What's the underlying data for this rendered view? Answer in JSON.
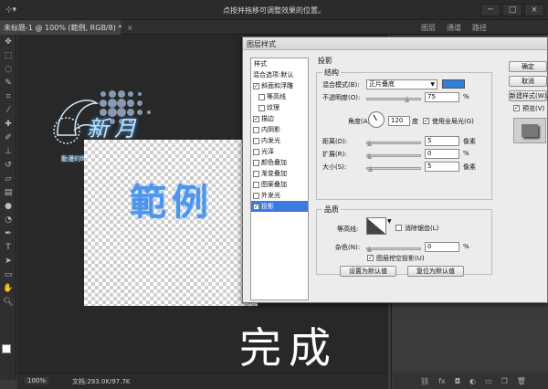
{
  "app": {
    "hint_text": "点按并拖移可调整效果的位置。",
    "tool_preset_icon": "crosshair-icon"
  },
  "document_tab": {
    "title": "未标题-1 @ 100% (範例, RGB/8) *",
    "close": "×"
  },
  "right_tabs": [
    "图层",
    "通道",
    "路径"
  ],
  "window_buttons": [
    "─",
    "□",
    "×"
  ],
  "canvas": {
    "sample_text": "範例",
    "logo_title": "新月",
    "logo_subtitle": "動漫的時期這比性   我們的一直很小心",
    "finish_text": "完成"
  },
  "status": {
    "zoom": "100%",
    "doc_info": "文档:293.0K/97.7K"
  },
  "dialog": {
    "title": "图层样式",
    "styles_header": "样式",
    "style_items": [
      {
        "label": "混合选项:默认",
        "checkbox": false,
        "checked": false,
        "indent": false,
        "selected": false
      },
      {
        "label": "斜面和浮雕",
        "checkbox": true,
        "checked": true,
        "indent": false,
        "selected": false
      },
      {
        "label": "等高线",
        "checkbox": true,
        "checked": false,
        "indent": true,
        "selected": false
      },
      {
        "label": "纹理",
        "checkbox": true,
        "checked": false,
        "indent": true,
        "selected": false
      },
      {
        "label": "描边",
        "checkbox": true,
        "checked": true,
        "indent": false,
        "selected": false
      },
      {
        "label": "内阴影",
        "checkbox": true,
        "checked": false,
        "indent": false,
        "selected": false
      },
      {
        "label": "内发光",
        "checkbox": true,
        "checked": false,
        "indent": false,
        "selected": false
      },
      {
        "label": "光泽",
        "checkbox": true,
        "checked": false,
        "indent": false,
        "selected": false
      },
      {
        "label": "颜色叠加",
        "checkbox": true,
        "checked": false,
        "indent": false,
        "selected": false
      },
      {
        "label": "渐变叠加",
        "checkbox": true,
        "checked": false,
        "indent": false,
        "selected": false
      },
      {
        "label": "图案叠加",
        "checkbox": true,
        "checked": false,
        "indent": false,
        "selected": false
      },
      {
        "label": "外发光",
        "checkbox": true,
        "checked": false,
        "indent": false,
        "selected": false
      },
      {
        "label": "投影",
        "checkbox": true,
        "checked": true,
        "indent": false,
        "selected": true
      }
    ],
    "section_title": "投影",
    "structure": {
      "title": "结构",
      "blend_mode_label": "混合模式(B):",
      "blend_mode_value": "正片叠底",
      "shadow_color": "#2f7fd8",
      "opacity_label": "不透明度(O):",
      "opacity_value": "75",
      "percent": "%",
      "angle_label": "角度(A):",
      "angle_value": "120",
      "degree": "度",
      "global_light_label": "使用全局光(G)",
      "global_light_checked": true,
      "distance_label": "距离(D):",
      "distance_value": "5",
      "spread_label": "扩展(R):",
      "spread_value": "0",
      "size_label": "大小(S):",
      "size_value": "5",
      "px": "像素"
    },
    "quality": {
      "title": "品质",
      "contour_label": "等高线:",
      "anti_alias_label": "消除锯齿(L)",
      "anti_alias_checked": false,
      "noise_label": "杂色(N):",
      "noise_value": "0",
      "knockout_label": "图层挖空投影(U)",
      "knockout_checked": true
    },
    "make_default": "设置为默认值",
    "reset_default": "复位为默认值",
    "ok": "确定",
    "cancel": "取消",
    "new_style": "新建样式(W)...",
    "preview_label": "预览(V)",
    "preview_checked": true
  },
  "tools": [
    "move-icon",
    "marquee-icon",
    "lasso-icon",
    "quick-select-icon",
    "crop-icon",
    "eyedropper-icon",
    "healing-icon",
    "brush-icon",
    "stamp-icon",
    "history-brush-icon",
    "eraser-icon",
    "gradient-icon",
    "blur-icon",
    "dodge-icon",
    "pen-icon",
    "type-icon",
    "path-select-icon",
    "shape-icon",
    "hand-icon",
    "zoom-icon"
  ]
}
